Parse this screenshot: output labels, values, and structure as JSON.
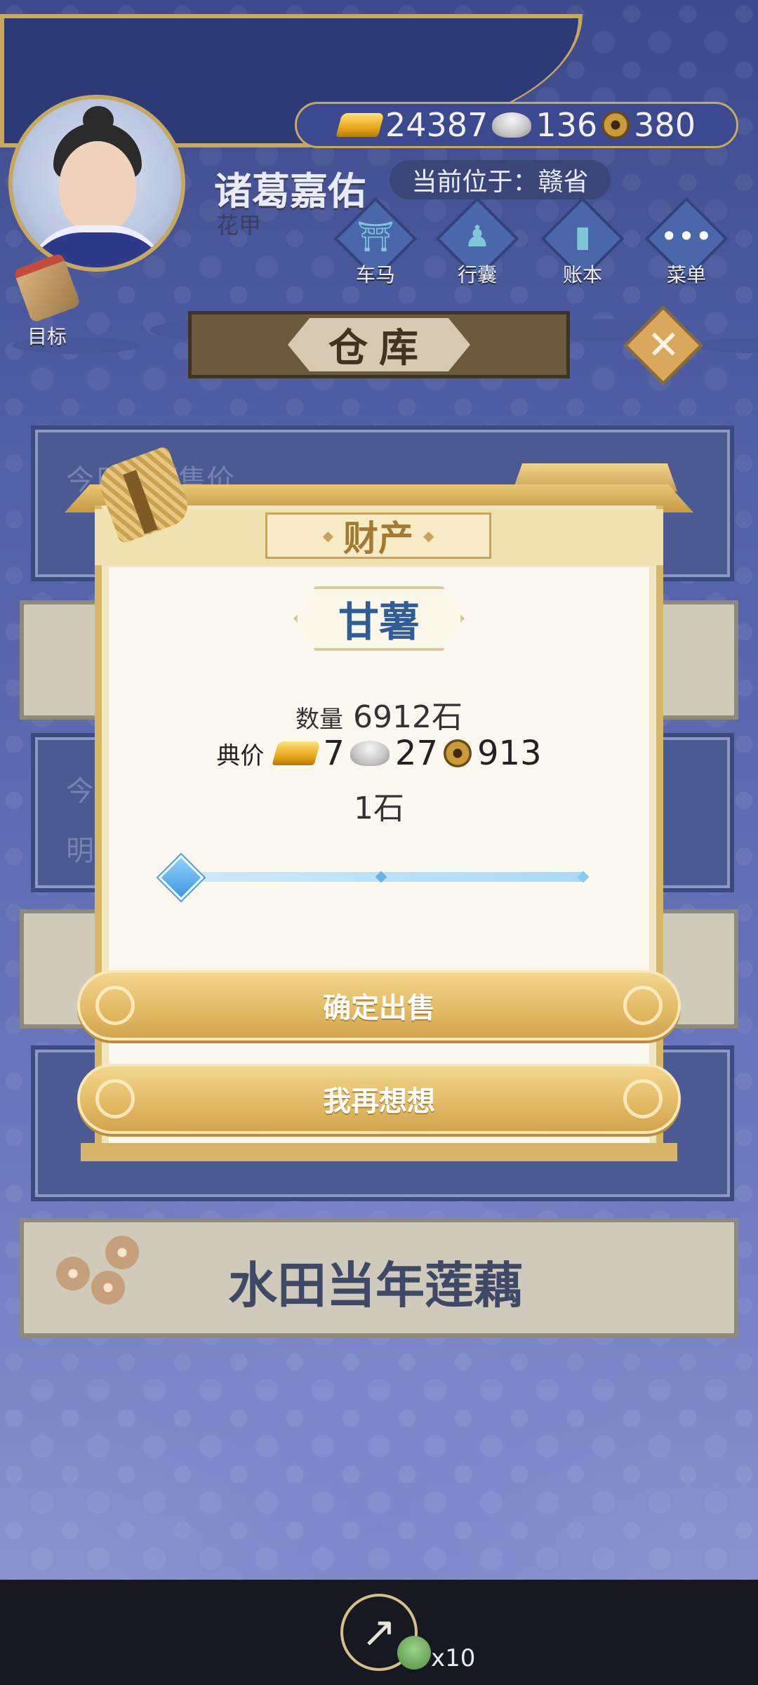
{
  "header": {
    "player_name": "诸葛嘉佑",
    "player_title": "花甲",
    "location": "当前位于：赣省",
    "currency": {
      "gold": "24387",
      "silver": "136",
      "copper": "380"
    }
  },
  "nav": {
    "carriage": "车马",
    "bag": "行囊",
    "ledger": "账本",
    "menu": "菜单",
    "goal": "目标"
  },
  "panel": {
    "title": "仓库",
    "close_symbol": "✕"
  },
  "background_cards": {
    "sweet_potato_price_partial": "今日甘薯售价",
    "partial_prefix_1": "今",
    "partial_prefix_2": "明",
    "lotus_title": "水田当年莲藕"
  },
  "dialog": {
    "tab_title": "财产",
    "item_name": "甘薯",
    "quantity_label": "数量",
    "quantity_value": "6912石",
    "price_label": "典价",
    "price": {
      "gold": "7",
      "silver": "27",
      "copper": "913"
    },
    "amount": "1石",
    "slider": {
      "min": 1,
      "max": 6912,
      "value": 1
    },
    "confirm_button": "确定出售",
    "cancel_button": "我再想想"
  },
  "bottom": {
    "share_count": "x10"
  }
}
